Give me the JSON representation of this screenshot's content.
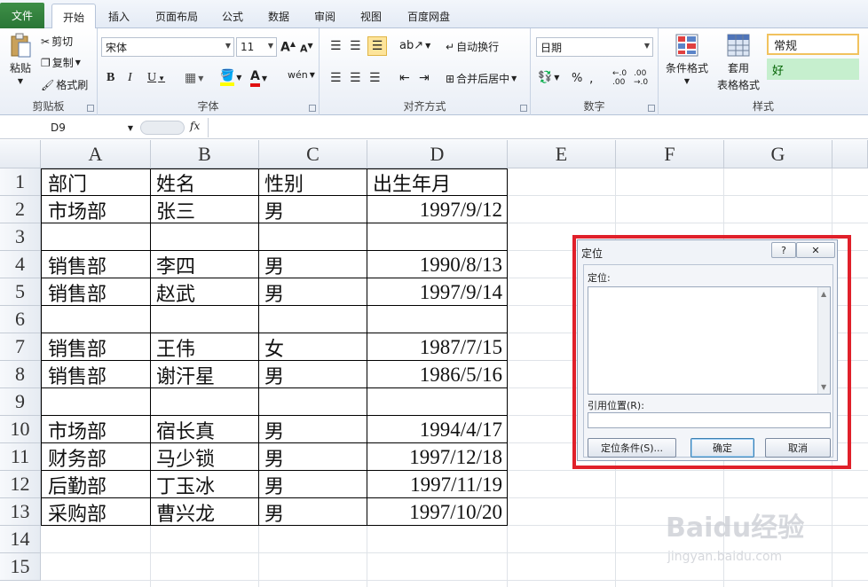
{
  "tabs": [
    "文件",
    "开始",
    "插入",
    "页面布局",
    "公式",
    "数据",
    "审阅",
    "视图",
    "百度网盘"
  ],
  "ribbon": {
    "clipboard": {
      "label": "剪贴板",
      "paste": "粘贴",
      "cut": "剪切",
      "copy": "复制",
      "format_painter": "格式刷"
    },
    "font": {
      "label": "字体",
      "font_name": "宋体",
      "font_size": "11"
    },
    "alignment": {
      "label": "对齐方式",
      "wrap_text": "自动换行",
      "merge_center": "合并后居中"
    },
    "number": {
      "label": "数字",
      "format": "日期"
    },
    "styles": {
      "label": "样式",
      "conditional": "条件格式",
      "table_format_1": "套用",
      "table_format_2": "表格格式",
      "normal": "常规",
      "good": "好"
    }
  },
  "formula_bar": {
    "name_box": "D9",
    "fx": "fx",
    "value": ""
  },
  "columns": [
    "A",
    "B",
    "C",
    "D",
    "E",
    "F",
    "G"
  ],
  "rows": [
    "1",
    "2",
    "3",
    "4",
    "5",
    "6",
    "7",
    "8",
    "9",
    "10",
    "11",
    "12",
    "13",
    "14",
    "15"
  ],
  "table": [
    [
      "部门",
      "姓名",
      "性别",
      "出生年月"
    ],
    [
      "市场部",
      "张三",
      "男",
      "1997/9/12"
    ],
    [
      "",
      "",
      "",
      ""
    ],
    [
      "销售部",
      "李四",
      "男",
      "1990/8/13"
    ],
    [
      "销售部",
      "赵武",
      "男",
      "1997/9/14"
    ],
    [
      "",
      "",
      "",
      ""
    ],
    [
      "销售部",
      "王伟",
      "女",
      "1987/7/15"
    ],
    [
      "销售部",
      "谢汗星",
      "男",
      "1986/5/16"
    ],
    [
      "",
      "",
      "",
      ""
    ],
    [
      "市场部",
      "宿长真",
      "男",
      "1994/4/17"
    ],
    [
      "财务部",
      "马少锁",
      "男",
      "1997/12/18"
    ],
    [
      "后勤部",
      "丁玉冰",
      "男",
      "1997/11/19"
    ],
    [
      "采购部",
      "曹兴龙",
      "男",
      "1997/10/20"
    ]
  ],
  "dialog": {
    "title": "定位",
    "help": "?",
    "close": "✕",
    "goto_label": "定位:",
    "ref_label": "引用位置(R):",
    "special_button": "定位条件(S)...",
    "ok_button": "确定",
    "cancel_button": "取消"
  },
  "watermark": {
    "main": "Baidu经验",
    "sub": "jingyan.baidu.com"
  },
  "colors": {
    "file_tab": "#2f7d3a",
    "highlight": "#e0202a",
    "good_style": "#c6efce",
    "normal_style": "#ffffff"
  }
}
